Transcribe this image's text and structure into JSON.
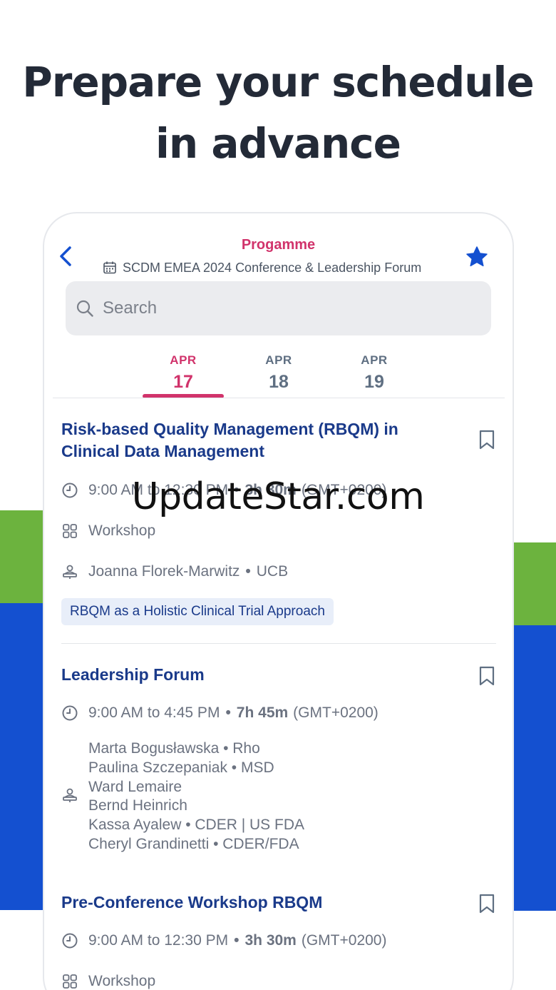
{
  "headline": "Prepare your schedule in advance",
  "watermark": "UpdateStar.com",
  "colors": {
    "accent": "#d1336b",
    "title_blue": "#1a3a8a",
    "green": "#6cb33e",
    "blue": "#1450d0"
  },
  "nav": {
    "title": "Progamme",
    "subtitle": "SCDM EMEA 2024 Conference & Leadership Forum",
    "back_icon": "chevron-left-icon",
    "favorite_icon": "star-icon"
  },
  "search": {
    "placeholder": "Search"
  },
  "dates": [
    {
      "month": "APR",
      "day": "17",
      "active": true
    },
    {
      "month": "APR",
      "day": "18",
      "active": false
    },
    {
      "month": "APR",
      "day": "19",
      "active": false
    }
  ],
  "sessions": [
    {
      "title": "Risk-based Quality Management (RBQM) in Clinical Data Management",
      "time": "9:00 AM to 12:30 PM",
      "duration": "3h 30m",
      "timezone": "(GMT+0200)",
      "type": "Workshop",
      "speaker": "Joanna Florek-Marwitz",
      "speaker_org": "UCB",
      "tag": "RBQM as a Holistic Clinical Trial Approach"
    },
    {
      "title": "Leadership Forum",
      "time": "9:00 AM to 4:45 PM",
      "duration": "7h 45m",
      "timezone": "(GMT+0200)",
      "speakers": [
        "Marta Bogusławska • Rho",
        "Paulina Szczepaniak • MSD",
        "Ward Lemaire",
        "Bernd Heinrich",
        "Kassa Ayalew • CDER | US FDA",
        "Cheryl Grandinetti • CDER/FDA"
      ]
    },
    {
      "title": "Pre-Conference Workshop RBQM",
      "time": "9:00 AM to 12:30 PM",
      "duration": "3h 30m",
      "timezone": "(GMT+0200)",
      "type": "Workshop"
    }
  ]
}
